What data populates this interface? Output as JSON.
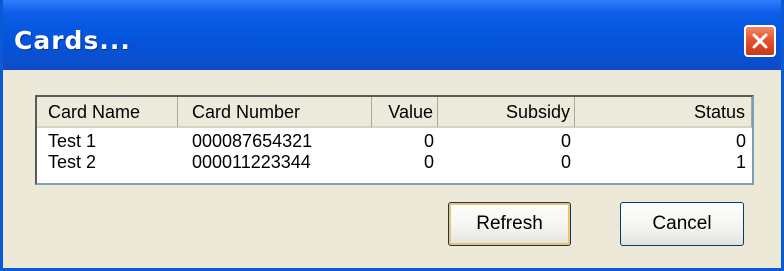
{
  "window": {
    "title": "Cards..."
  },
  "list": {
    "columns": [
      "Card Name",
      "Card Number",
      "Value",
      "Subsidy",
      "Status"
    ],
    "rows": [
      {
        "name": "Test 1",
        "number": "000087654321",
        "value": "0",
        "subsidy": "0",
        "status": "0"
      },
      {
        "name": "Test 2",
        "number": "000011223344",
        "value": "0",
        "subsidy": "0",
        "status": "1"
      }
    ]
  },
  "buttons": {
    "refresh": "Refresh",
    "cancel": "Cancel"
  },
  "colors": {
    "titlebar": "#0355dc",
    "close": "#e3552d",
    "window_bg": "#ece9d8"
  }
}
